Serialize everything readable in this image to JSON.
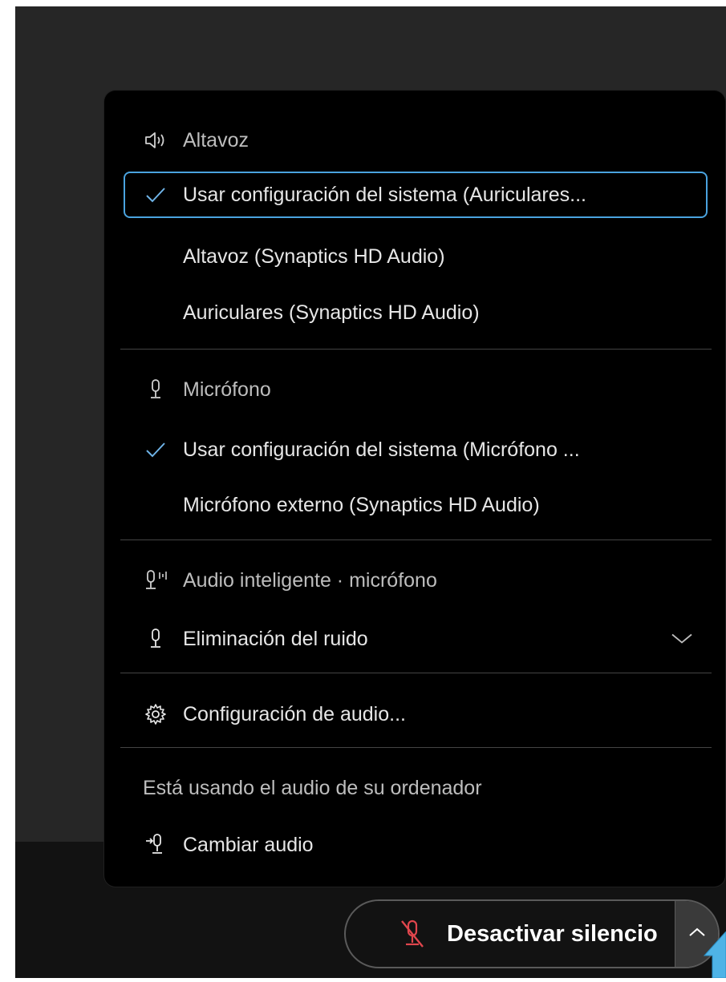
{
  "speaker": {
    "header": "Altavoz",
    "icon": "speaker-icon",
    "options": [
      {
        "label": "Usar configuración del sistema (Auriculares...",
        "checked": true
      },
      {
        "label": "Altavoz (Synaptics HD Audio)",
        "checked": false
      },
      {
        "label": "Auriculares (Synaptics HD Audio)",
        "checked": false
      }
    ]
  },
  "microphone": {
    "header": "Micrófono",
    "icon": "microphone-icon",
    "options": [
      {
        "label": "Usar configuración del sistema (Micrófono ...",
        "checked": true
      },
      {
        "label": "Micrófono externo (Synaptics HD Audio)",
        "checked": false
      }
    ]
  },
  "smart_audio": {
    "header": "Audio inteligente · micrófono",
    "icon": "smart-audio-mic-icon",
    "noise_removal": {
      "label": "Eliminación del ruido",
      "icon": "microphone-icon"
    }
  },
  "audio_settings": {
    "label": "Configuración de audio...",
    "icon": "gear-icon"
  },
  "status_text": "Está usando el audio de su ordenador",
  "switch_audio": {
    "label": "Cambiar audio",
    "icon": "switch-audio-icon"
  },
  "unmute_button": {
    "label": "Desactivar silencio",
    "icon": "mic-muted-icon",
    "icon_color": "#e0464d"
  },
  "colors": {
    "accent": "#4aa3df",
    "menu_bg": "#000000",
    "muted_red": "#e0464d"
  }
}
